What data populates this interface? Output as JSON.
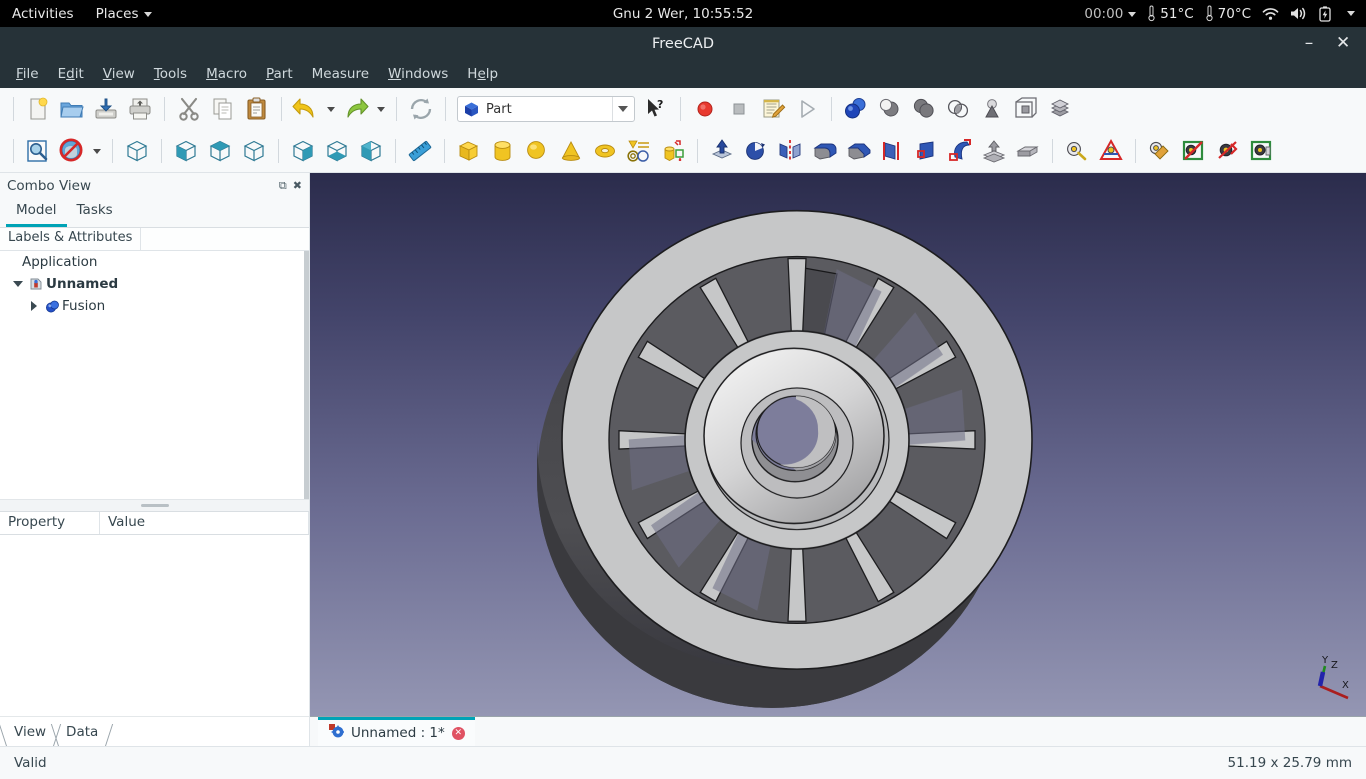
{
  "desktop": {
    "activities": "Activities",
    "places": "Places",
    "clock": "Gnu  2 Wer, 10:55:52",
    "timer": "00:00",
    "temp1": "51°C",
    "temp2": "70°C",
    "icons": [
      "thermometer-icon",
      "thermometer-icon",
      "wifi-icon",
      "volume-icon",
      "battery-icon",
      "chevron-down-icon"
    ]
  },
  "window": {
    "title": "FreeCAD",
    "minimize": "–",
    "close": "✕"
  },
  "menubar": {
    "items": [
      {
        "label": "File",
        "accel": "F"
      },
      {
        "label": "Edit",
        "accel": "E"
      },
      {
        "label": "View",
        "accel": "V"
      },
      {
        "label": "Tools",
        "accel": "T"
      },
      {
        "label": "Macro",
        "accel": "M"
      },
      {
        "label": "Part",
        "accel": "P"
      },
      {
        "label": "Measure",
        "accel": ""
      },
      {
        "label": "Windows",
        "accel": "W"
      },
      {
        "label": "Help",
        "accel": "H"
      }
    ]
  },
  "toolbar_row1": {
    "file_group": [
      "new-document-icon",
      "open-folder-icon",
      "save-icon",
      "print-icon"
    ],
    "edit_group": [
      "cut-scissors-icon",
      "copy-icon",
      "paste-icon"
    ],
    "history_group": [
      "undo-icon",
      "undo-dropdown-icon",
      "redo-icon",
      "redo-dropdown-icon"
    ],
    "refresh_group": [
      "refresh-icon"
    ],
    "workbench": {
      "selected": "Part",
      "icon": "part-cube-icon",
      "dropdown": "chevron-down-icon"
    },
    "whatsthis": "whats-this-icon",
    "macro_group": [
      "macro-record-icon",
      "macro-stop-icon",
      "macro-edit-icon",
      "macro-execute-icon"
    ],
    "boolean_group": [
      "boolean-icon",
      "cut-solid-icon",
      "union-icon",
      "common-icon",
      "join-icon",
      "compound-icon",
      "compound-filter-icon"
    ]
  },
  "toolbar_row2": {
    "view_group": [
      "fit-all-icon",
      "draw-style-icon",
      "draw-style-dropdown-icon"
    ],
    "std_views": [
      "axonometric-icon",
      "front-view-icon",
      "top-view-icon",
      "right-view-icon",
      "rear-view-icon",
      "bottom-view-icon",
      "left-view-icon"
    ],
    "measure_group": [
      "measure-ruler-icon"
    ],
    "primitives": [
      "box-icon",
      "cylinder-icon",
      "sphere-icon",
      "cone-icon",
      "torus-icon",
      "shape-builder-icon",
      "primitives-dialog-icon"
    ],
    "modeling": [
      "extrude-icon",
      "revolve-icon",
      "mirror-icon",
      "fillet-icon",
      "chamfer-icon",
      "ruled-surface-icon",
      "loft-icon",
      "sweep-icon",
      "section-icon",
      "cross-sections-icon"
    ],
    "measure_tools": [
      "measure-linear-icon",
      "measure-angular-icon",
      "measure-refresh-icon",
      "measure-toggle-all-icon",
      "measure-toggle-delta-icon",
      "measure-clear-all-icon"
    ]
  },
  "combo_view": {
    "title": "Combo View",
    "float_button": "⧉",
    "close_button": "✖",
    "tabs": [
      {
        "label": "Model",
        "active": true
      },
      {
        "label": "Tasks",
        "active": false
      }
    ],
    "tree_header": "Labels & Attributes",
    "tree": [
      {
        "label": "Application",
        "level": 0,
        "twist": "none",
        "icon": "none",
        "bold": false
      },
      {
        "label": "Unnamed",
        "level": 1,
        "twist": "open",
        "icon": "document-icon",
        "bold": true
      },
      {
        "label": "Fusion",
        "level": 2,
        "twist": "closed",
        "icon": "fusion-icon",
        "bold": false
      }
    ],
    "property_header": {
      "property": "Property",
      "value": "Value"
    },
    "bottom_tabs": [
      {
        "label": "View"
      },
      {
        "label": "Data"
      }
    ]
  },
  "view3d": {
    "background_top": "#2b2c4c",
    "background_bottom": "#9496b3",
    "model_name": "fusion-wheel-model",
    "material_light": "#c9cacb",
    "material_dark": "#58585c",
    "axis_labels": {
      "x": "X",
      "y": "Y",
      "z": "Z"
    },
    "axis_colors": {
      "x": "#aa1e1e",
      "y": "#1e8a1e",
      "z": "#2323aa"
    }
  },
  "document_tabs": [
    {
      "label": "Unnamed : 1*",
      "icon": "freecad-doc-icon",
      "close": "✕",
      "active": true
    }
  ],
  "statusbar": {
    "left": "Valid",
    "right": "51.19 x 25.79 mm"
  }
}
